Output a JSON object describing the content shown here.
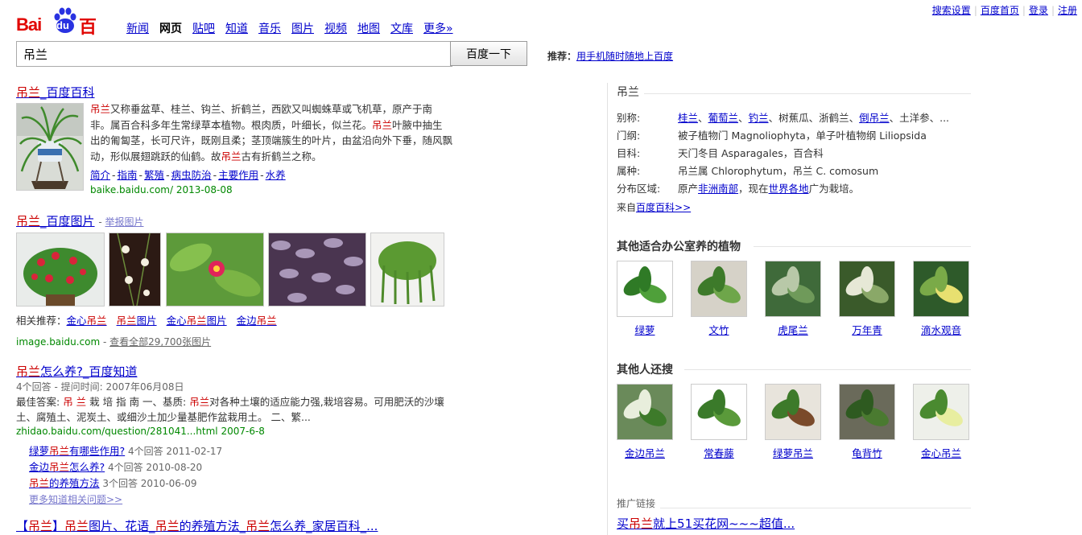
{
  "top_links": [
    "搜索设置",
    "百度首页",
    "登录",
    "注册"
  ],
  "logo": {
    "bai": "Bai",
    "du": "du",
    "cn": "百度"
  },
  "nav": [
    {
      "label": "新闻",
      "current": false
    },
    {
      "label": "网页",
      "current": true
    },
    {
      "label": "贴吧",
      "current": false
    },
    {
      "label": "知道",
      "current": false
    },
    {
      "label": "音乐",
      "current": false
    },
    {
      "label": "图片",
      "current": false
    },
    {
      "label": "视频",
      "current": false
    },
    {
      "label": "地图",
      "current": false
    },
    {
      "label": "文库",
      "current": false
    },
    {
      "label": "更多»",
      "current": false
    }
  ],
  "search": {
    "value": "吊兰",
    "button": "百度一下"
  },
  "recommend": {
    "label": "推荐：",
    "link": "用手机随时随地上百度"
  },
  "result1": {
    "title_hl": "吊兰",
    "title_rest": "_百度百科",
    "abstract": [
      {
        "t": "吊兰",
        "hl": true
      },
      {
        "t": "又称垂盆草、桂兰、钩兰、折鹤兰，西欧又叫蜘蛛草或飞机草，原产于南非。属百合科多年生常绿草本植物。根肉质，叶细长，似兰花。",
        "hl": false
      },
      {
        "t": "吊兰",
        "hl": true
      },
      {
        "t": "叶腋中抽生出的匍匐茎，长可尺许，既刚且柔；茎顶端簇生的叶片，由盆沿向外下垂，随风飘动，形似展翅跳跃的仙鹤。故",
        "hl": false
      },
      {
        "t": "吊兰",
        "hl": true
      },
      {
        "t": "古有折鹤兰之称。",
        "hl": false
      }
    ],
    "links": [
      "简介",
      "指南",
      "繁殖",
      "病虫防治",
      "主要作用",
      "水养"
    ],
    "url": "baike.baidu.com/ 2013-08-08"
  },
  "result2": {
    "title_hl": "吊兰",
    "title_rest": "_百度图片",
    "report": "举报图片",
    "related_label": "相关推荐：",
    "related": [
      [
        {
          "t": "金心",
          "hl": false
        },
        {
          "t": "吊兰",
          "hl": true
        }
      ],
      [
        {
          "t": "吊兰",
          "hl": true
        },
        {
          "t": "图片",
          "hl": false
        }
      ],
      [
        {
          "t": "金心",
          "hl": false
        },
        {
          "t": "吊兰",
          "hl": true
        },
        {
          "t": "图片",
          "hl": false
        }
      ],
      [
        {
          "t": "金边",
          "hl": false
        },
        {
          "t": "吊兰",
          "hl": true
        }
      ]
    ],
    "url": "image.baidu.com",
    "sep": " - ",
    "more": "查看全部29,700张图片"
  },
  "result3": {
    "title_hl": "吊兰",
    "title_rest": "怎么养?_百度知道",
    "meta": "4个回答 - 提问时间: 2007年06月08日",
    "abstract": [
      {
        "t": "最佳答案: ",
        "hl": false
      },
      {
        "t": "吊 兰",
        "hl": true
      },
      {
        "t": " 栽 培 指 南 一、基质: ",
        "hl": false
      },
      {
        "t": "吊兰",
        "hl": true
      },
      {
        "t": "对各种土壤的适应能力强,栽培容易。可用肥沃的沙壤土、腐殖土、泥炭土、或细沙土加少量基肥作盆栽用土。 二、繁...",
        "hl": false
      }
    ],
    "url": "zhidao.baidu.com/question/281041...html  2007-6-8",
    "subs": [
      {
        "pre": "绿萝",
        "hl": "吊兰",
        "post": "有哪些作用?",
        "meta": " 4个回答  2011-02-17"
      },
      {
        "pre": "金边",
        "hl": "吊兰",
        "post": "怎么养?",
        "meta": " 4个回答  2010-08-20"
      },
      {
        "pre": "",
        "hl": "吊兰",
        "post": "的养殖方法",
        "meta": " 3个回答  2010-06-09"
      }
    ],
    "more": "更多知道相关问题>>"
  },
  "result4": {
    "parts": [
      {
        "t": "【",
        "hl": false
      },
      {
        "t": "吊兰",
        "hl": true
      },
      {
        "t": "】",
        "hl": false
      },
      {
        "t": "吊兰",
        "hl": true
      },
      {
        "t": "图片、花语_",
        "hl": false
      },
      {
        "t": "吊兰",
        "hl": true
      },
      {
        "t": "的养殖方法_",
        "hl": false
      },
      {
        "t": "吊兰",
        "hl": true
      },
      {
        "t": "怎么养_家居百科_...",
        "hl": false
      }
    ]
  },
  "right": {
    "title": "吊兰",
    "rows": [
      {
        "k": "别称:",
        "v": [
          {
            "t": "桂兰",
            "link": true
          },
          {
            "t": "、",
            "link": false
          },
          {
            "t": "葡萄兰",
            "link": true
          },
          {
            "t": "、",
            "link": false
          },
          {
            "t": "钓兰",
            "link": true
          },
          {
            "t": "、树蕉瓜、浙鹤兰、",
            "link": false
          },
          {
            "t": "倒吊兰",
            "link": true
          },
          {
            "t": "、土洋参、...",
            "link": false
          }
        ]
      },
      {
        "k": "门纲:",
        "v": [
          {
            "t": "被子植物门 Magnoliophyta，单子叶植物纲 Liliopsida",
            "link": false
          }
        ]
      },
      {
        "k": "目科:",
        "v": [
          {
            "t": "天门冬目 Asparagales，百合科",
            "link": false
          }
        ]
      },
      {
        "k": "属种:",
        "v": [
          {
            "t": "吊兰属 Chlorophytum，吊兰 C. comosum",
            "link": false
          }
        ]
      },
      {
        "k": "分布区域:",
        "v": [
          {
            "t": "原产",
            "link": false
          },
          {
            "t": "非洲南部",
            "link": true
          },
          {
            "t": "，现在",
            "link": false
          },
          {
            "t": "世界各地",
            "link": true
          },
          {
            "t": "广为栽培。",
            "link": false
          }
        ]
      }
    ],
    "source_label": "来自",
    "source_link": "百度百科>>",
    "office_heading": "其他适合办公室养的植物",
    "office_plants": [
      "绿萝",
      "文竹",
      "虎尾兰",
      "万年青",
      "滴水观音"
    ],
    "others_heading": "其他人还搜",
    "other_plants": [
      "金边吊兰",
      "常春藤",
      "绿萝吊兰",
      "龟背竹",
      "金心吊兰"
    ],
    "ad_label": "推广链接",
    "ad_title": [
      {
        "t": "买",
        "hl": false
      },
      {
        "t": "吊兰",
        "hl": true
      },
      {
        "t": "就上51买花网~~~超值...",
        "hl": false
      }
    ]
  },
  "colors": {
    "link": "#0000cc",
    "highlight": "#cc0000",
    "url": "#008000",
    "brand_red": "#e10602",
    "brand_blue": "#2932e1"
  }
}
